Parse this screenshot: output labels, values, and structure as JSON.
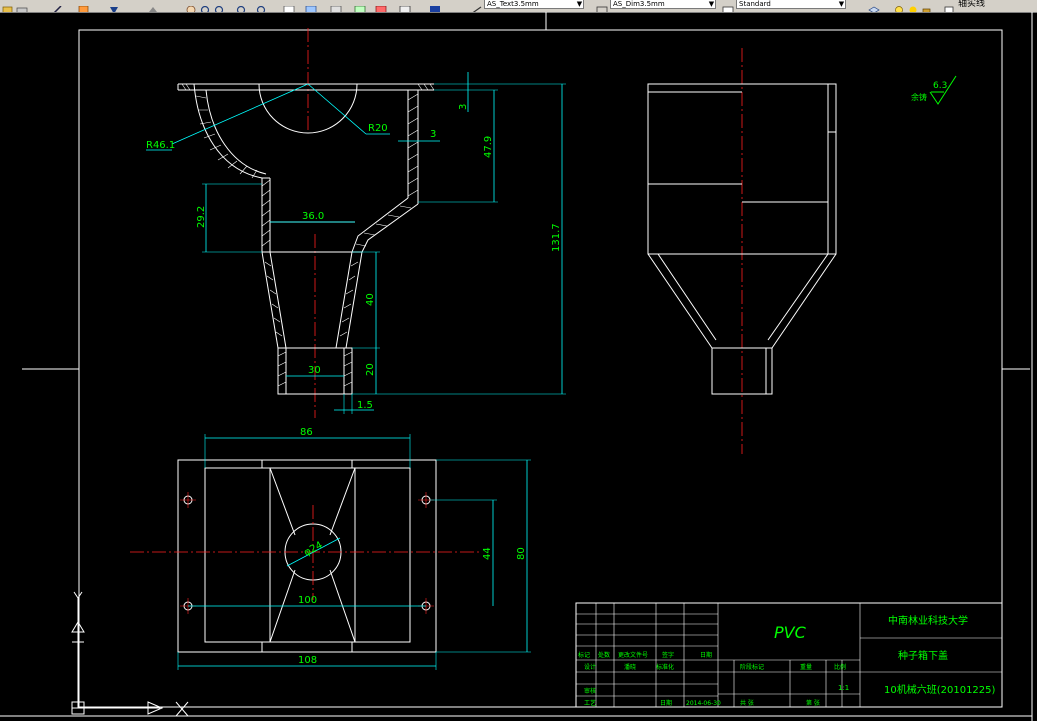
{
  "toolbar": {
    "text_style": "AS_Text3.5mm",
    "dim_style": "AS_Dim3.5mm",
    "table_style": "Standard",
    "layer_label": "轴实线"
  },
  "front_view": {
    "r_outer": "R46.1",
    "r_inner": "R20",
    "d_3a": "3",
    "d_3b": "3",
    "d_479": "47.9",
    "d_1317": "131.7",
    "d_292": "29.2",
    "d_360": "36.0",
    "d_40": "40",
    "d_30": "30",
    "d_20": "20",
    "d_15": "1.5"
  },
  "top_view": {
    "d_86": "86",
    "phi24": "φ24",
    "d_100": "100",
    "d_108": "108",
    "d_44": "44",
    "d_80": "80"
  },
  "roughness": {
    "label": "余铸",
    "value": "6.3"
  },
  "title_block": {
    "material": "PVC",
    "school": "中南林业科技大学",
    "part_name": "种子箱下盖",
    "drawing_no": "10机械六班(20101225)",
    "scale": "1:1",
    "h_mark": "标记",
    "h_count": "处数",
    "h_doc": "更改文件号",
    "h_sign": "签字",
    "h_date": "日期",
    "r_design": "设计",
    "r_name": "潘晓",
    "r_std": "标准化",
    "r_review": "审核",
    "r_process": "工艺",
    "r_approve_date": "日期",
    "r_date_val": "2014-06-30",
    "h_stage": "阶段标记",
    "h_weight": "重量",
    "h_ratio": "比例",
    "r_sheets": "共 张",
    "r_sheet": "第 张"
  }
}
